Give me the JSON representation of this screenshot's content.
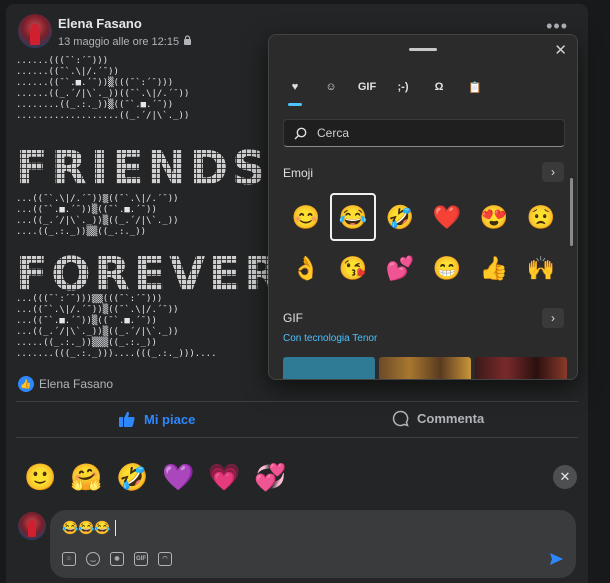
{
  "post": {
    "author": "Elena Fasano",
    "timestamp": "13 maggio alle ore 12:15",
    "privacy_icon": "lock-icon",
    "more_icon": "more-icon",
    "art_lines_top": [
      "......(((¯`:´¯)))",
      "......((¯`.\\|/.´¯))",
      "......((¯`.■.´¯))▒(((¯`:´¯)))",
      "......((_.´/|\\`._))((¯`.\\|/.´¯))",
      "........((_.:._))▒((¯`.■.´¯))",
      "...................((_.´/|\\`._))"
    ],
    "art_word_1": "FRIENDS",
    "art_lines_mid": [
      "...((¯`.\\|/.´¯))▒((¯`.\\|/.´¯))",
      "...((¯`.■.´¯))▒((¯`.■.´¯))",
      "...((_.´/|\\`._))▒((_.´/|\\`._))",
      "....((_.:._))▒▒((_.:._))"
    ],
    "art_word_2": "FOREVER",
    "art_lines_bottom": [
      "...(((¯`:´¯)))▒▒(((¯`:´¯)))",
      "...((¯`.\\|/.´¯))▒((¯`.\\|/.´¯))",
      "...((¯`.■.´¯))▒((¯`.■.´¯))",
      "...((_.´/|\\`._))▒((_.´/|\\`._))",
      ".....((_.:._))▒▒▒((_.:._))",
      ".......(((_.:._)))....(((_.:._)))...."
    ],
    "reactions_name": "Elena Fasano"
  },
  "actions": {
    "like_label": "Mi piace",
    "comment_label": "Commenta"
  },
  "quick_reactions": [
    "🙂",
    "🤗",
    "🤣",
    "💜",
    "💗",
    "💞"
  ],
  "comment": {
    "text": "😂😂😂",
    "tool_gif_label": "GIF"
  },
  "emoji_panel": {
    "tabs": [
      {
        "name": "tab-favorites",
        "glyph": "♥"
      },
      {
        "name": "tab-emoji",
        "glyph": "☺"
      },
      {
        "name": "tab-gif",
        "glyph": "GIF"
      },
      {
        "name": "tab-kaomoji",
        "glyph": ";-)"
      },
      {
        "name": "tab-symbols",
        "glyph": "Ω"
      },
      {
        "name": "tab-clipboard",
        "glyph": "📋"
      }
    ],
    "search_placeholder": "Cerca",
    "emoji_section": "Emoji",
    "emojis": [
      "😊",
      "😂",
      "🤣",
      "❤️",
      "😍",
      "😟",
      "👌",
      "😘",
      "💕",
      "😁",
      "👍",
      "🙌"
    ],
    "selected_index": 1,
    "gif_section": "GIF",
    "tenor_label": "Con tecnologia Tenor"
  },
  "colors": {
    "accent_blue": "#2d88ff",
    "panel_accent": "#4cc2ff",
    "background": "#18191a",
    "card": "#242526"
  }
}
